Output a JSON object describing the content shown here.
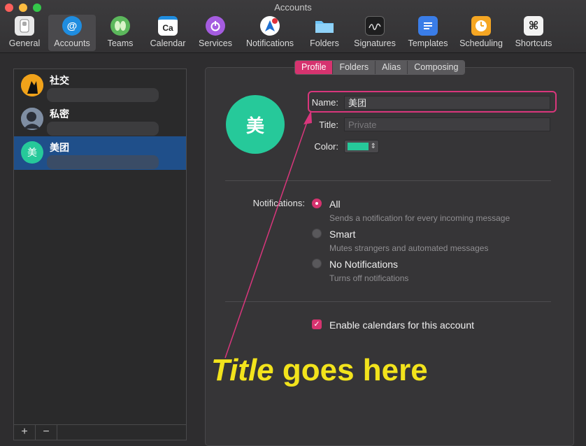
{
  "window": {
    "title": "Accounts"
  },
  "toolbar": [
    {
      "label": "General",
      "icon": "general-switch-icon"
    },
    {
      "label": "Accounts",
      "icon": "at-sign-icon",
      "selected": true
    },
    {
      "label": "Teams",
      "icon": "teams-icon"
    },
    {
      "label": "Calendar",
      "icon": "calendar-icon",
      "glyph": "Ca"
    },
    {
      "label": "Services",
      "icon": "power-icon"
    },
    {
      "label": "Notifications",
      "icon": "notifications-icon"
    },
    {
      "label": "Folders",
      "icon": "folder-icon"
    },
    {
      "label": "Signatures",
      "icon": "signature-icon"
    },
    {
      "label": "Templates",
      "icon": "templates-icon"
    },
    {
      "label": "Scheduling",
      "icon": "clock-icon"
    },
    {
      "label": "Shortcuts",
      "icon": "command-icon",
      "glyph": "⌘"
    }
  ],
  "accounts": [
    {
      "name": "社交",
      "selected": false
    },
    {
      "name": "私密",
      "selected": false
    },
    {
      "name": "美团",
      "avatar_text": "美",
      "selected": true
    }
  ],
  "list_buttons": {
    "add": "+",
    "remove": "−"
  },
  "tabs": [
    "Profile",
    "Folders",
    "Alias",
    "Composing"
  ],
  "active_tab": "Profile",
  "profile": {
    "avatar_text": "美",
    "avatar_color": "#26c99a",
    "name_label": "Name:",
    "name_value": "美团",
    "title_label": "Title:",
    "title_placeholder": "Private",
    "color_label": "Color:",
    "color_value": "#26c99a"
  },
  "notifications": {
    "label": "Notifications:",
    "selected": "All",
    "options": [
      {
        "title": "All",
        "desc": "Sends a notification for every incoming message"
      },
      {
        "title": "Smart",
        "desc": "Mutes strangers and automated messages"
      },
      {
        "title": "No Notifications",
        "desc": "Turns off notifications"
      }
    ]
  },
  "calendar": {
    "label": "Enable calendars for this account",
    "checked": true
  },
  "annotation": {
    "emphasis": "Title",
    "rest": " goes here",
    "color": "#f2e31c"
  },
  "colors": {
    "accent": "#d6336f",
    "selection": "#1f4f8a",
    "annotation_outline": "#d9367c"
  }
}
